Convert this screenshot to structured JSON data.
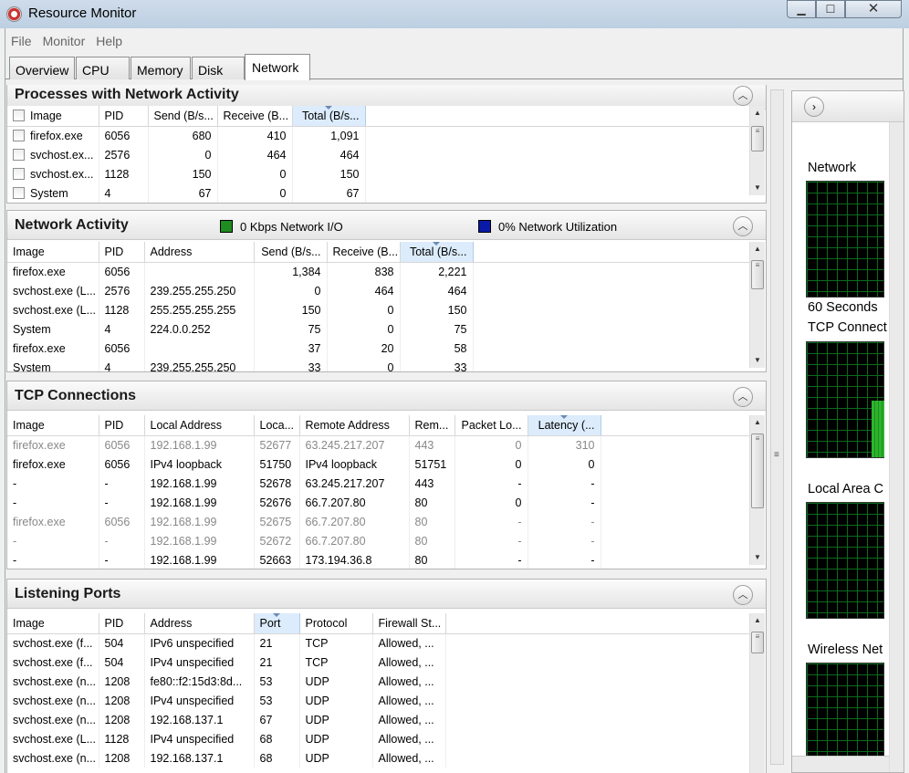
{
  "window": {
    "title": "Resource Monitor",
    "min": "▁",
    "max": "☐",
    "close": "✕"
  },
  "menu": [
    "File",
    "Monitor",
    "Help"
  ],
  "tabs": [
    "Overview",
    "CPU",
    "Memory",
    "Disk",
    "Network"
  ],
  "active_tab": "Network",
  "processes": {
    "title": "Processes with Network Activity",
    "columns": [
      "Image",
      "PID",
      "Send (B/s...",
      "Receive (B...",
      "Total (B/s..."
    ],
    "rows": [
      [
        "firefox.exe",
        "6056",
        "680",
        "410",
        "1,091"
      ],
      [
        "svchost.ex...",
        "2576",
        "0",
        "464",
        "464"
      ],
      [
        "svchost.ex...",
        "1128",
        "150",
        "0",
        "150"
      ],
      [
        "System",
        "4",
        "67",
        "0",
        "67"
      ]
    ]
  },
  "network_activity": {
    "title": "Network Activity",
    "legend_io": "0 Kbps Network I/O",
    "legend_util": "0% Network Utilization",
    "io_color": "#1f8c1f",
    "util_color": "#0a1aa8",
    "columns": [
      "Image",
      "PID",
      "Address",
      "Send (B/s...",
      "Receive (B...",
      "Total (B/s..."
    ],
    "rows": [
      [
        "firefox.exe",
        "6056",
        "",
        "1,384",
        "838",
        "2,221"
      ],
      [
        "svchost.exe (L...",
        "2576",
        "239.255.255.250",
        "0",
        "464",
        "464"
      ],
      [
        "svchost.exe (L...",
        "1128",
        "255.255.255.255",
        "150",
        "0",
        "150"
      ],
      [
        "System",
        "4",
        "224.0.0.252",
        "75",
        "0",
        "75"
      ],
      [
        "firefox.exe",
        "6056",
        "",
        "37",
        "20",
        "58"
      ],
      [
        "System",
        "4",
        "239.255.255.250",
        "33",
        "0",
        "33"
      ]
    ]
  },
  "tcp": {
    "title": "TCP Connections",
    "columns": [
      "Image",
      "PID",
      "Local Address",
      "Loca...",
      "Remote Address",
      "Rem...",
      "Packet Lo...",
      "Latency (..."
    ],
    "rows": [
      {
        "gray": true,
        "cells": [
          "firefox.exe",
          "6056",
          "192.168.1.99",
          "52677",
          "63.245.217.207",
          "443",
          "0",
          "310"
        ]
      },
      {
        "gray": false,
        "cells": [
          "firefox.exe",
          "6056",
          "IPv4 loopback",
          "51750",
          "IPv4 loopback",
          "51751",
          "0",
          "0"
        ]
      },
      {
        "gray": false,
        "cells": [
          "-",
          "-",
          "192.168.1.99",
          "52678",
          "63.245.217.207",
          "443",
          "-",
          "-"
        ]
      },
      {
        "gray": false,
        "cells": [
          "-",
          "-",
          "192.168.1.99",
          "52676",
          "66.7.207.80",
          "80",
          "0",
          "-"
        ]
      },
      {
        "gray": true,
        "cells": [
          "firefox.exe",
          "6056",
          "192.168.1.99",
          "52675",
          "66.7.207.80",
          "80",
          "-",
          "-"
        ]
      },
      {
        "gray": true,
        "cells": [
          "-",
          "-",
          "192.168.1.99",
          "52672",
          "66.7.207.80",
          "80",
          "-",
          "-"
        ]
      },
      {
        "gray": false,
        "cells": [
          "-",
          "-",
          "192.168.1.99",
          "52663",
          "173.194.36.8",
          "80",
          "-",
          "-"
        ]
      }
    ]
  },
  "listening": {
    "title": "Listening Ports",
    "columns": [
      "Image",
      "PID",
      "Address",
      "Port",
      "Protocol",
      "Firewall St..."
    ],
    "rows": [
      [
        "svchost.exe (f...",
        "504",
        "IPv6 unspecified",
        "21",
        "TCP",
        "Allowed, ..."
      ],
      [
        "svchost.exe (f...",
        "504",
        "IPv4 unspecified",
        "21",
        "TCP",
        "Allowed, ..."
      ],
      [
        "svchost.exe (n...",
        "1208",
        "fe80::f2:15d3:8d...",
        "53",
        "UDP",
        "Allowed, ..."
      ],
      [
        "svchost.exe (n...",
        "1208",
        "IPv4 unspecified",
        "53",
        "UDP",
        "Allowed, ..."
      ],
      [
        "svchost.exe (n...",
        "1208",
        "192.168.137.1",
        "67",
        "UDP",
        "Allowed, ..."
      ],
      [
        "svchost.exe (L...",
        "1128",
        "IPv4 unspecified",
        "68",
        "UDP",
        "Allowed, ..."
      ],
      [
        "svchost.exe (n...",
        "1208",
        "192.168.137.1",
        "68",
        "UDP",
        "Allowed, ..."
      ]
    ]
  },
  "right_panel": {
    "graphs": [
      "Network",
      "TCP Connect",
      "Local Area C",
      "Wireless Net"
    ],
    "time_label": "60 Seconds"
  }
}
